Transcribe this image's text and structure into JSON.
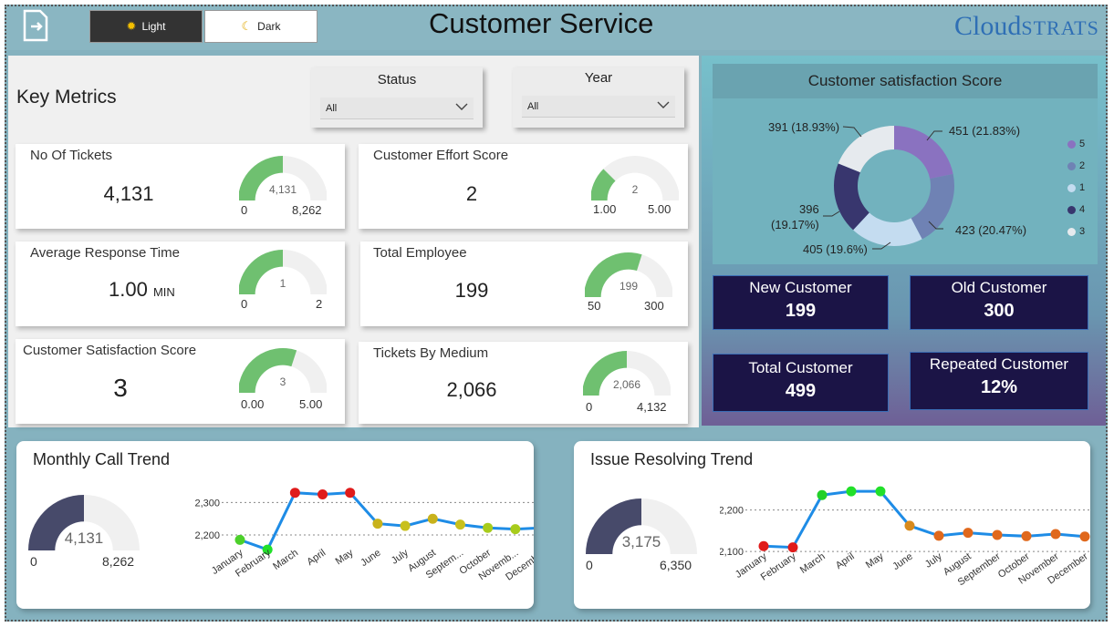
{
  "header": {
    "title": "Customer Service",
    "logo_text_a": "Cloud",
    "logo_text_b": "STRATS",
    "theme_light": "Light",
    "theme_dark": "Dark"
  },
  "filters": {
    "heading": "Key Metrics",
    "status": {
      "label": "Status",
      "value": "All"
    },
    "year": {
      "label": "Year",
      "value": "All"
    }
  },
  "metrics": {
    "tickets": {
      "title": "No Of Tickets",
      "value": "4,131",
      "gauge_value": "4,131",
      "min": "0",
      "max": "8,262",
      "fraction": 0.5
    },
    "effort": {
      "title": "Customer Effort Score",
      "value": "2",
      "gauge_value": "2",
      "min": "1.00",
      "max": "5.00",
      "fraction": 0.25
    },
    "response": {
      "title": "Average Response Time",
      "value": "1.00",
      "unit": "MIN",
      "gauge_value": "1",
      "min": "0",
      "max": "2",
      "fraction": 0.5
    },
    "employee": {
      "title": "Total Employee",
      "value": "199",
      "gauge_value": "199",
      "min": "50",
      "max": "300",
      "fraction": 0.596
    },
    "satisfaction": {
      "title": "Customer Satisfaction Score",
      "value": "3",
      "gauge_value": "3",
      "min": "0.00",
      "max": "5.00",
      "fraction": 0.6
    },
    "medium": {
      "title": "Tickets By Medium",
      "value": "2,066",
      "gauge_value": "2,066",
      "min": "0",
      "max": "4,132",
      "fraction": 0.5
    }
  },
  "satisfaction_chart": {
    "title": "Customer satisfaction Score",
    "slices": [
      {
        "legend": "5",
        "label": "451 (21.83%)",
        "value": 451,
        "color": "#8a72c0"
      },
      {
        "legend": "2",
        "label": "423 (20.47%)",
        "value": 423,
        "color": "#6f82b4"
      },
      {
        "legend": "1",
        "label": "405 (19.6%)",
        "value": 405,
        "color": "#c4dcf0"
      },
      {
        "legend": "4",
        "label_a": "396",
        "label_b": "(19.17%)",
        "value": 396,
        "color": "#38366e"
      },
      {
        "legend": "3",
        "label": "391 (18.93%)",
        "value": 391,
        "color": "#e6eaee"
      }
    ],
    "legend_order": [
      {
        "name": "5",
        "color": "#8a72c0"
      },
      {
        "name": "2",
        "color": "#6f82b4"
      },
      {
        "name": "1",
        "color": "#c4dcf0"
      },
      {
        "name": "4",
        "color": "#38366e"
      },
      {
        "name": "3",
        "color": "#e6eaee"
      }
    ]
  },
  "kpis": {
    "new": {
      "label": "New Customer",
      "value": "199"
    },
    "old": {
      "label": "Old Customer",
      "value": "300"
    },
    "total": {
      "label": "Total Customer",
      "value": "499"
    },
    "repeated": {
      "label": "Repeated Customer",
      "value": "12%"
    }
  },
  "monthly_call": {
    "title": "Monthly Call Trend",
    "gauge_value": "4,131",
    "min": "0",
    "max": "8,262",
    "fraction": 0.5,
    "y_ticks": [
      "2,300",
      "2,200"
    ]
  },
  "issue_resolving": {
    "title": "Issue Resolving Trend",
    "gauge_value": "3,175",
    "min": "0",
    "max": "6,350",
    "fraction": 0.5,
    "y_ticks": [
      "2,200",
      "2,100"
    ]
  },
  "chart_data": [
    {
      "type": "line",
      "title": "Monthly Call Trend",
      "categories": [
        "January",
        "February",
        "March",
        "April",
        "May",
        "June",
        "July",
        "August",
        "Septem...",
        "October",
        "Novemb...",
        "December"
      ],
      "series": [
        {
          "values": [
            2185,
            2155,
            2330,
            2325,
            2330,
            2235,
            2228,
            2250,
            2232,
            2222,
            2218,
            2222
          ]
        }
      ],
      "point_colors": [
        "#4cd02a",
        "#22e02a",
        "#e01b1b",
        "#e01b1b",
        "#e01b1b",
        "#c8b21c",
        "#c8c01c",
        "#c8b21c",
        "#c8c01c",
        "#a8cc1c",
        "#a8cc1c",
        "#a8cc1c"
      ],
      "ylim": [
        2130,
        2360
      ],
      "y_ticks": [
        2200,
        2300
      ]
    },
    {
      "type": "line",
      "title": "Issue Resolving Trend",
      "categories": [
        "January",
        "February",
        "March",
        "April",
        "May",
        "June",
        "July",
        "August",
        "September",
        "October",
        "November",
        "December"
      ],
      "series": [
        {
          "values": [
            2113,
            2110,
            2236,
            2245,
            2245,
            2162,
            2138,
            2145,
            2140,
            2137,
            2142,
            2136
          ]
        }
      ],
      "point_colors": [
        "#e01b1b",
        "#e01b1b",
        "#22d02a",
        "#22e02a",
        "#22e02a",
        "#d88a1c",
        "#e0681c",
        "#e0681c",
        "#e0681c",
        "#e0681c",
        "#e0681c",
        "#e0681c"
      ],
      "ylim": [
        2085,
        2265
      ],
      "y_ticks": [
        2100,
        2200
      ]
    }
  ]
}
